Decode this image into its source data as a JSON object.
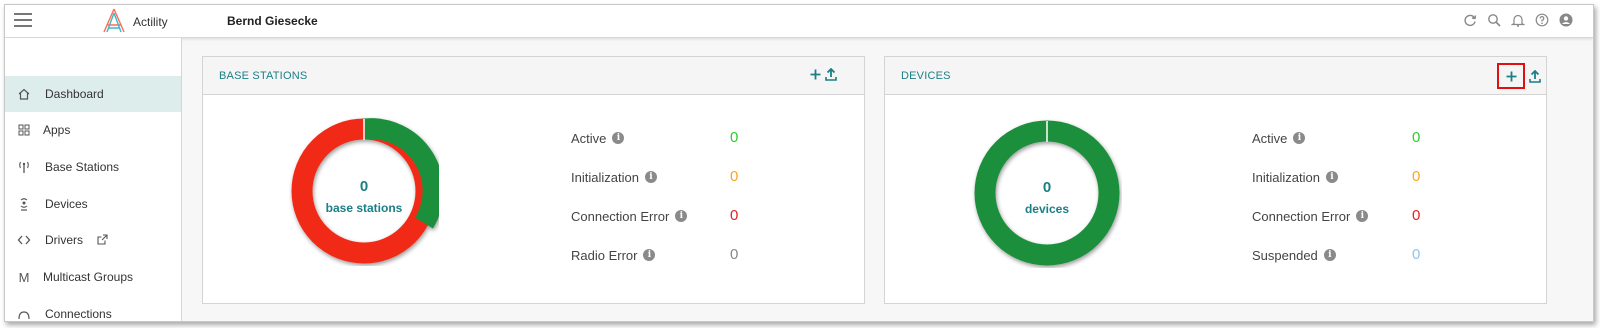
{
  "app": {
    "brand": "Actility",
    "user_name": "Bernd Giesecke",
    "top_icons": [
      "refresh-icon",
      "search-icon",
      "bell-icon",
      "help-icon",
      "user-icon"
    ]
  },
  "sidebar": {
    "items": [
      {
        "label": "Dashboard",
        "icon": "home-icon",
        "active": true
      },
      {
        "label": "Apps",
        "icon": "grid-icon"
      },
      {
        "label": "Base Stations",
        "icon": "antenna-icon"
      },
      {
        "label": "Devices",
        "icon": "device-icon"
      },
      {
        "label": "Drivers",
        "icon": "code-icon",
        "external_icon": "external-link-icon"
      },
      {
        "label": "Multicast Groups",
        "icon": "multicast-icon"
      },
      {
        "label": "Connections",
        "icon": "connections-icon"
      }
    ]
  },
  "base_stations": {
    "title": "BASE STATIONS",
    "count": "0",
    "count_label": "base stations",
    "stats": [
      {
        "label": "Active",
        "value": "0",
        "color": "#2ecc2e"
      },
      {
        "label": "Initialization",
        "value": "0",
        "color": "#f5a623"
      },
      {
        "label": "Connection Error",
        "value": "0",
        "color": "#e62020"
      },
      {
        "label": "Radio Error",
        "value": "0",
        "color": "#888888"
      }
    ],
    "donut_colors": {
      "green": "#1e8f3e",
      "red": "#f02a17"
    }
  },
  "devices": {
    "title": "DEVICES",
    "count": "0",
    "count_label": "devices",
    "stats": [
      {
        "label": "Active",
        "value": "0",
        "color": "#2ecc2e"
      },
      {
        "label": "Initialization",
        "value": "0",
        "color": "#f5a623"
      },
      {
        "label": "Connection Error",
        "value": "0",
        "color": "#e62020"
      },
      {
        "label": "Suspended",
        "value": "0",
        "color": "#8fc3ee"
      }
    ],
    "donut_colors": {
      "green": "#1e8f3e"
    }
  },
  "colors": {
    "accent": "#1b7f86",
    "active_nav_bg": "#dcedec",
    "highlight": "#e01010"
  }
}
